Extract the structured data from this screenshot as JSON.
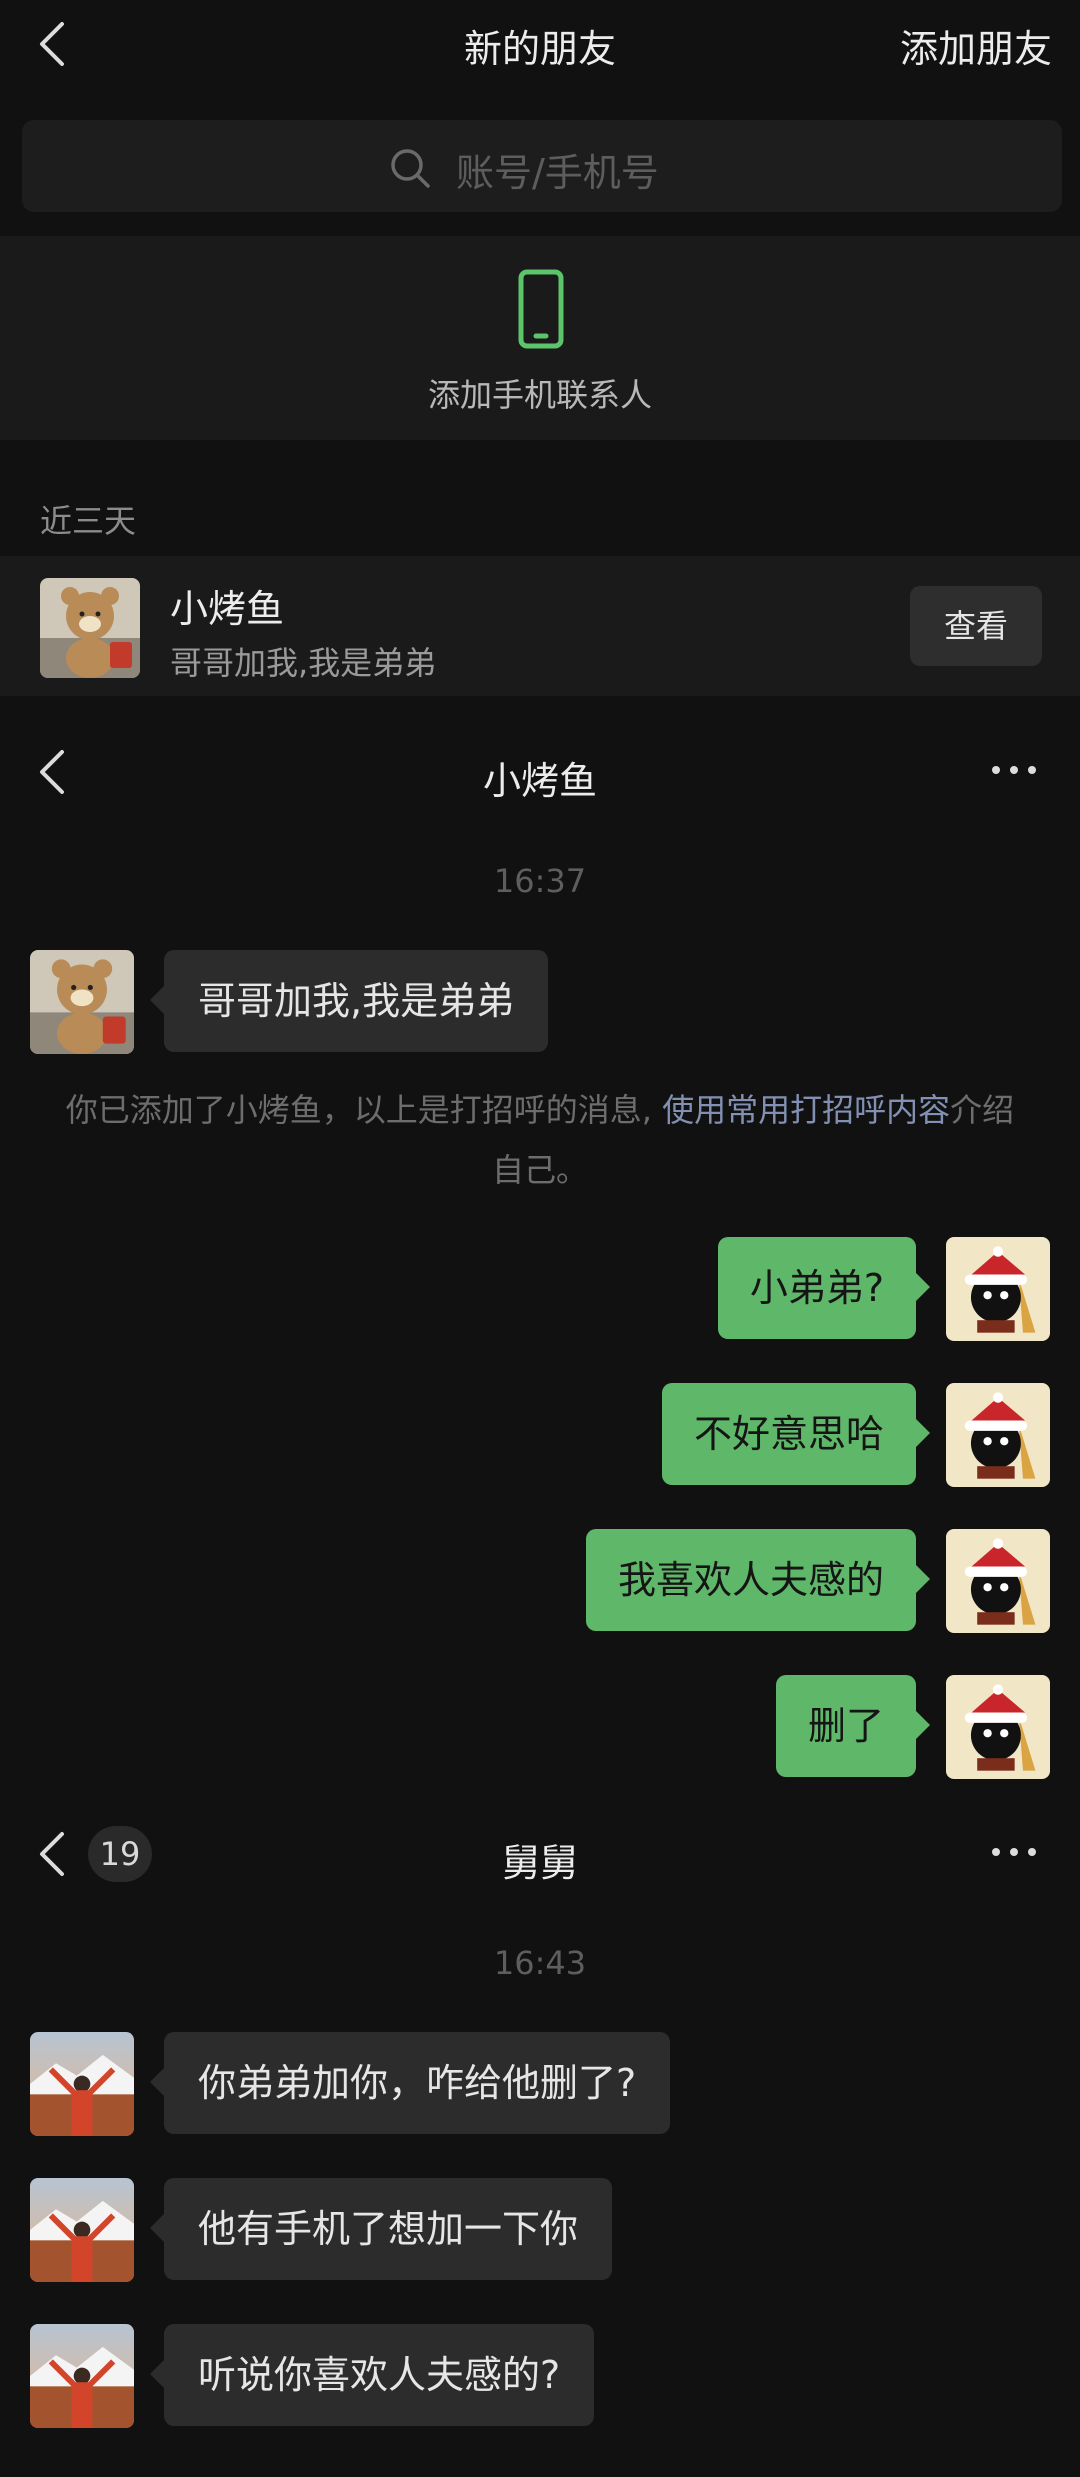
{
  "new_friends": {
    "title": "新的朋友",
    "add_friends": "添加朋友",
    "search_placeholder": "账号/手机号",
    "add_phone_contacts": "添加手机联系人",
    "section_label": "近三天",
    "friend": {
      "name": "小烤鱼",
      "message": "哥哥加我,我是弟弟",
      "action": "查看"
    }
  },
  "chat1": {
    "title": "小烤鱼",
    "time": "16:37",
    "incoming": "哥哥加我,我是弟弟",
    "system_pre": "你已添加了小烤鱼，以上是打招呼的消息, ",
    "system_link": "使用常用打招呼内容",
    "system_post": "介绍自己。",
    "outgoing": [
      "小弟弟?",
      "不好意思哈",
      "我喜欢人夫感的",
      "删了"
    ]
  },
  "chat2": {
    "title": "舅舅",
    "unread_badge": "19",
    "time": "16:43",
    "incoming": [
      "你弟弟加你，咋给他删了?",
      "他有手机了想加一下你",
      "听说你喜欢人夫感的?"
    ]
  },
  "colors": {
    "background": "#111111",
    "bubble_outgoing": "#5fb86a",
    "bubble_incoming": "#2c2c2c",
    "accent_green": "#5cc46b",
    "link": "#8291b3"
  },
  "icons": [
    "back-chevron-icon",
    "search-icon",
    "mobile-phone-icon",
    "more-dots-icon"
  ]
}
